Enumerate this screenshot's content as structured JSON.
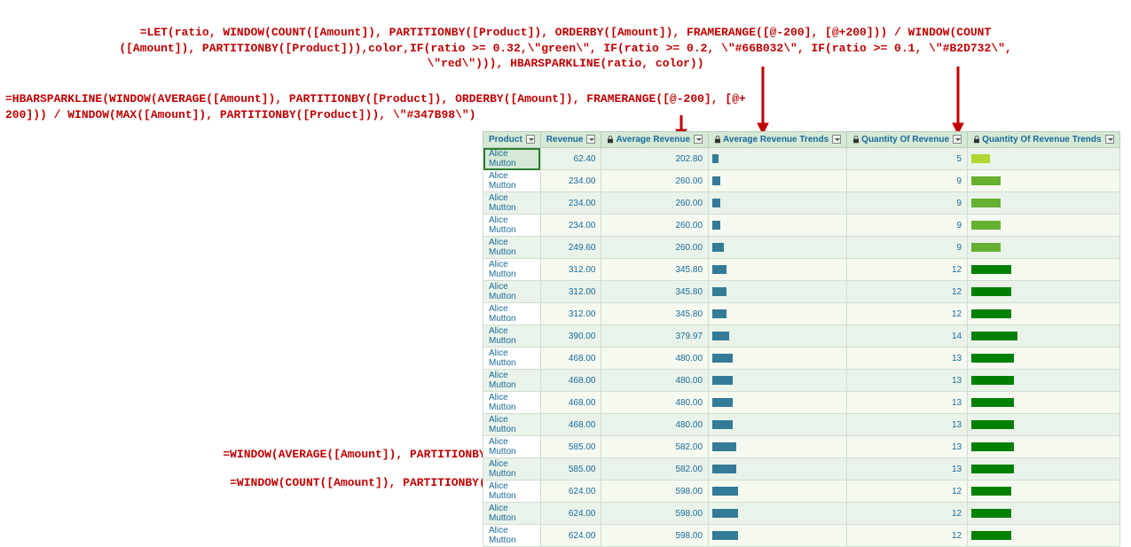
{
  "formulas": {
    "top": "=LET(ratio, WINDOW(COUNT([Amount]), PARTITIONBY([Product]), ORDERBY([Amount]), FRAMERANGE([@-200], [@+200])) / WINDOW(COUNT\n([Amount]), PARTITIONBY([Product])),color,IF(ratio >= 0.32,\\\"green\\\", IF(ratio >= 0.2, \\\"#66B032\\\", IF(ratio >= 0.1, \\\"#B2D732\\\",\n\\\"red\\\"))), HBARSPARKLINE(ratio, color))",
    "left": "=HBARSPARKLINE(WINDOW(AVERAGE([Amount]), PARTITIONBY([Product]), ORDERBY([Amount]), FRAMERANGE([@-200], [@+\n200])) / WINDOW(MAX([Amount]), PARTITIONBY([Product])), \\\"#347B98\\\")",
    "bottom1": "=WINDOW(AVERAGE([Amount]), PARTITIONBY([Product]), ORDERBY([Amount]), FRAMERANGE([@-200], [@+200]))",
    "bottom2": "=WINDOW(COUNT([Amount]), PARTITIONBY([Product]), ORDERBY([Amount]), FRAMERANGE([@-200], [@+200]))"
  },
  "headers": {
    "product": "Product",
    "revenue": "Revenue",
    "avg": "Average Revenue",
    "avg_trend": "Average Revenue Trends",
    "qty": "Quantity Of Revenue",
    "qty_trend": "Quantity Of Revenue Trends"
  },
  "product_label": "Alice Mutton",
  "rows": [
    {
      "rev": "62.40",
      "avg": "202.80",
      "avgbar": 7,
      "qty": "5",
      "qtybar": 21,
      "qcolor": "#b2d732"
    },
    {
      "rev": "234.00",
      "avg": "260.00",
      "avgbar": 9,
      "qty": "9",
      "qtybar": 33,
      "qcolor": "#66b032"
    },
    {
      "rev": "234.00",
      "avg": "260.00",
      "avgbar": 9,
      "qty": "9",
      "qtybar": 33,
      "qcolor": "#66b032"
    },
    {
      "rev": "234.00",
      "avg": "260.00",
      "avgbar": 9,
      "qty": "9",
      "qtybar": 33,
      "qcolor": "#66b032"
    },
    {
      "rev": "249.60",
      "avg": "260.00",
      "avgbar": 13,
      "qty": "9",
      "qtybar": 33,
      "qcolor": "#66b032"
    },
    {
      "rev": "312.00",
      "avg": "345.80",
      "avgbar": 16,
      "qty": "12",
      "qtybar": 45,
      "qcolor": "#008000"
    },
    {
      "rev": "312.00",
      "avg": "345.80",
      "avgbar": 16,
      "qty": "12",
      "qtybar": 45,
      "qcolor": "#008000"
    },
    {
      "rev": "312.00",
      "avg": "345.80",
      "avgbar": 16,
      "qty": "12",
      "qtybar": 45,
      "qcolor": "#008000"
    },
    {
      "rev": "390.00",
      "avg": "379.97",
      "avgbar": 19,
      "qty": "14",
      "qtybar": 52,
      "qcolor": "#008000"
    },
    {
      "rev": "468.00",
      "avg": "480.00",
      "avgbar": 23,
      "qty": "13",
      "qtybar": 48,
      "qcolor": "#008000"
    },
    {
      "rev": "468.00",
      "avg": "480.00",
      "avgbar": 23,
      "qty": "13",
      "qtybar": 48,
      "qcolor": "#008000"
    },
    {
      "rev": "468.00",
      "avg": "480.00",
      "avgbar": 23,
      "qty": "13",
      "qtybar": 48,
      "qcolor": "#008000"
    },
    {
      "rev": "468.00",
      "avg": "480.00",
      "avgbar": 23,
      "qty": "13",
      "qtybar": 48,
      "qcolor": "#008000"
    },
    {
      "rev": "585.00",
      "avg": "582.00",
      "avgbar": 27,
      "qty": "13",
      "qtybar": 48,
      "qcolor": "#008000"
    },
    {
      "rev": "585.00",
      "avg": "582.00",
      "avgbar": 27,
      "qty": "13",
      "qtybar": 48,
      "qcolor": "#008000"
    },
    {
      "rev": "624.00",
      "avg": "598.00",
      "avgbar": 29,
      "qty": "12",
      "qtybar": 45,
      "qcolor": "#008000"
    },
    {
      "rev": "624.00",
      "avg": "598.00",
      "avgbar": 29,
      "qty": "12",
      "qtybar": 45,
      "qcolor": "#008000"
    },
    {
      "rev": "624.00",
      "avg": "598.00",
      "avgbar": 29,
      "qty": "12",
      "qtybar": 45,
      "qcolor": "#008000"
    }
  ]
}
